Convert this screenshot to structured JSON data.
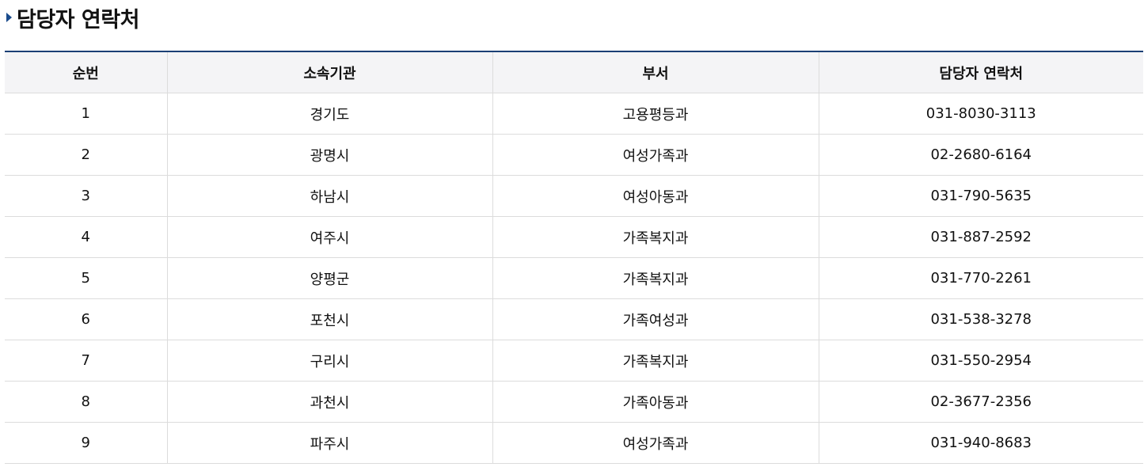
{
  "heading": {
    "icon": "triangle-right-icon",
    "title": "담당자 연락처",
    "accent_color": "#1a4b8c"
  },
  "table": {
    "header_border_color": "#1a3f75",
    "columns": [
      "순번",
      "소속기관",
      "부서",
      "담당자 연락처"
    ],
    "rows": [
      {
        "no": "1",
        "agency": "경기도",
        "department": "고용평등과",
        "phone": "031-8030-3113"
      },
      {
        "no": "2",
        "agency": "광명시",
        "department": "여성가족과",
        "phone": "02-2680-6164"
      },
      {
        "no": "3",
        "agency": "하남시",
        "department": "여성아동과",
        "phone": "031-790-5635"
      },
      {
        "no": "4",
        "agency": "여주시",
        "department": "가족복지과",
        "phone": "031-887-2592"
      },
      {
        "no": "5",
        "agency": "양평군",
        "department": "가족복지과",
        "phone": "031-770-2261"
      },
      {
        "no": "6",
        "agency": "포천시",
        "department": "가족여성과",
        "phone": "031-538-3278"
      },
      {
        "no": "7",
        "agency": "구리시",
        "department": "가족복지과",
        "phone": "031-550-2954"
      },
      {
        "no": "8",
        "agency": "과천시",
        "department": "가족아동과",
        "phone": "02-3677-2356"
      },
      {
        "no": "9",
        "agency": "파주시",
        "department": "여성가족과",
        "phone": "031-940-8683"
      }
    ]
  }
}
